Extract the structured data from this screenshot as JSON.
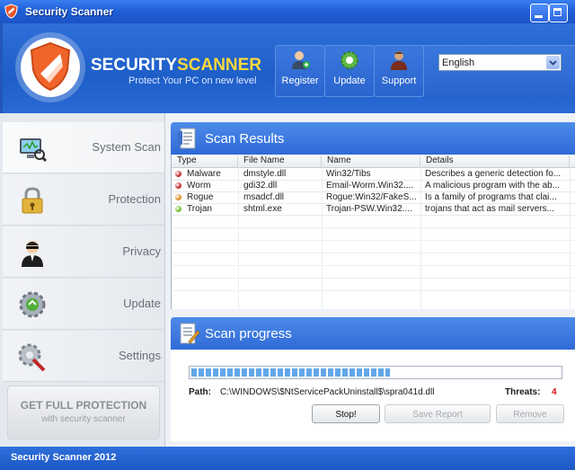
{
  "window": {
    "title": "Security Scanner"
  },
  "header": {
    "brand_part1": "SECURITY",
    "brand_part2": "SCANNER",
    "tagline": "Protect Your PC on new level",
    "buttons": [
      {
        "label": "Register",
        "icon": "user-add-icon"
      },
      {
        "label": "Update",
        "icon": "gear-refresh-icon"
      },
      {
        "label": "Support",
        "icon": "support-agent-icon"
      }
    ],
    "language": {
      "selected": "English"
    }
  },
  "sidebar": {
    "items": [
      {
        "label": "System Scan",
        "icon": "magnifier-monitor-icon"
      },
      {
        "label": "Protection",
        "icon": "padlock-icon"
      },
      {
        "label": "Privacy",
        "icon": "spy-person-icon"
      },
      {
        "label": "Update",
        "icon": "gear-refresh-icon"
      },
      {
        "label": "Settings",
        "icon": "gear-wrench-icon"
      }
    ],
    "get_full": {
      "line1": "GET FULL PROTECTION",
      "line2": "with security scanner"
    }
  },
  "results": {
    "title": "Scan Results",
    "columns": [
      "Type",
      "File Name",
      "Name",
      "Details"
    ],
    "rows": [
      {
        "type": "Malware",
        "file": "dmstyle.dll",
        "name": "Win32/Tibs",
        "details": "Describes a generic detection fo...",
        "color": "#c62828"
      },
      {
        "type": "Worm",
        "file": "gdi32.dll",
        "name": "Email-Worm.Win32....",
        "details": "A malicious program with the ab...",
        "color": "#c62828"
      },
      {
        "type": "Rogue",
        "file": "msadcf.dll",
        "name": "Rogue:Win32/FakeS...",
        "details": "Is a family of programs that clai...",
        "color": "#e08a1c"
      },
      {
        "type": "Trojan",
        "file": "shtml.exe",
        "name": "Trojan-PSW.Win32....",
        "details": "trojans that act as mail servers...",
        "color": "#6fbf2a"
      }
    ]
  },
  "progress": {
    "title": "Scan progress",
    "percent": 54,
    "path_label": "Path:",
    "path_value": "C:\\WINDOWS\\$NtServicePackUninstall$\\spra041d.dll",
    "threats_label": "Threats:",
    "threats_value": "4",
    "buttons": {
      "stop": "Stop!",
      "save": "Save Report",
      "remove": "Remove"
    }
  },
  "footer": {
    "text": "Security Scanner 2012"
  },
  "colors": {
    "accent": "#2f6ad7",
    "brand_yellow": "#ffd83b",
    "threat_red": "#dd1111"
  }
}
